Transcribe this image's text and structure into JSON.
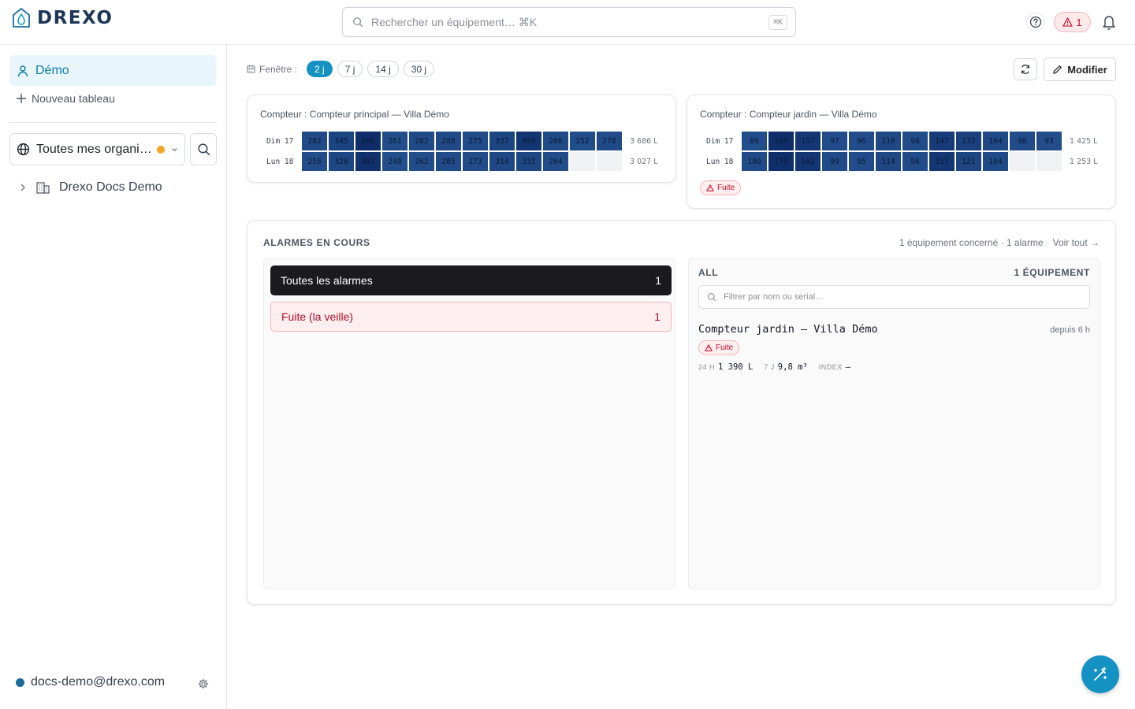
{
  "app": {
    "logo_text": "DREXO"
  },
  "header": {
    "search_placeholder": "Rechercher un équipement… ⌘K",
    "search_shortcut": "⌘K",
    "alert_count": "1"
  },
  "sidebar": {
    "dashboard": "Démo",
    "new_board": "Nouveau tableau",
    "org_selector": "Toutes mes organi…",
    "tree_item": "Drexo Docs Demo",
    "user_email": "docs-demo@drexo.com"
  },
  "toolbar": {
    "window_label": "Fenêtre :",
    "windows": [
      "2 j",
      "7 j",
      "14 j",
      "30 j"
    ],
    "active_window": "2 j",
    "edit_label": "Modifier"
  },
  "meters": [
    {
      "title": "Compteur : Compteur principal — Villa Démo",
      "rows": [
        {
          "day": "Dim 17",
          "values": [
            282,
            345,
            506,
            261,
            282,
            288,
            275,
            337,
            459,
            286,
            252,
            278
          ],
          "total": "3 686  L"
        },
        {
          "day": "Lun 18",
          "values": [
            258,
            328,
            481,
            240,
            262,
            285,
            273,
            314,
            331,
            264,
            null,
            null
          ],
          "total": "3 027  L"
        }
      ]
    },
    {
      "title": "Compteur : Compteur jardin — Villa Démo",
      "rows": [
        {
          "day": "Dim 17",
          "values": [
            89,
            180,
            157,
            97,
            96,
            110,
            98,
            147,
            132,
            104,
            98,
            93
          ],
          "total": "1 425  L"
        },
        {
          "day": "Lun 18",
          "values": [
            100,
            176,
            162,
            99,
            95,
            114,
            96,
            157,
            121,
            104,
            null,
            null
          ],
          "total": "1 253  L"
        }
      ],
      "badge": "Fuite"
    }
  ],
  "alarms": {
    "title": "ALARMES EN COURS",
    "summary": "1 équipement concerné · 1 alarme",
    "see_all": "Voir tout →",
    "categories": [
      {
        "label": "Toutes les alarmes",
        "count": "1"
      },
      {
        "label": "Fuite (la veille)",
        "count": "1"
      }
    ],
    "panel": {
      "scope": "ALL",
      "count_label": "1 ÉQUIPEMENT",
      "filter_placeholder": "Filtrer par nom ou serial…",
      "device": {
        "name": "Compteur jardin — Villa Démo",
        "since": "depuis 6 h",
        "badge": "Fuite",
        "stat_24h_label": "24 H",
        "stat_24h_value": "1 390  L",
        "stat_7j_label": "7 J",
        "stat_7j_value": "9,8  m³",
        "index_label": "INDEX",
        "index_value": "–"
      }
    }
  },
  "colors": {
    "accent": "#1592c4",
    "danger": "#c8102e",
    "navy": "#1d3557"
  }
}
